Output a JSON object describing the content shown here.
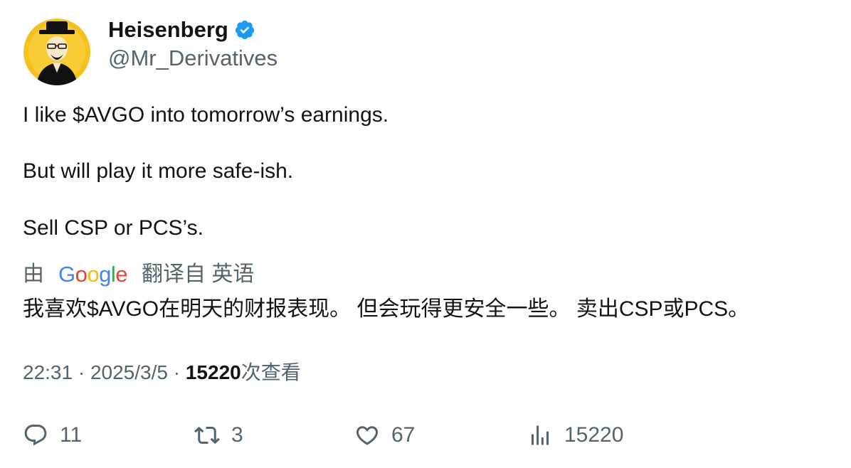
{
  "author": {
    "display_name": "Heisenberg",
    "handle": "@Mr_Derivatives",
    "verified": true
  },
  "tweet": {
    "lines": [
      "I like $AVGO into tomorrow’s earnings.",
      "But will play it more safe-ish.",
      "Sell CSP or PCS’s."
    ]
  },
  "translation": {
    "prefix": "由",
    "provider": "Google",
    "suffix": "翻译自 英语",
    "text": "我喜欢$AVGO在明天的财报表现。 但会玩得更安全一些。 卖出CSP或PCS。"
  },
  "meta": {
    "time": "22:31",
    "separator": "·",
    "date": "2025/3/5",
    "views_count": "15220",
    "views_label": "次查看"
  },
  "actions": {
    "replies": "11",
    "retweets": "3",
    "likes": "67",
    "views": "15220"
  },
  "colors": {
    "verified_blue": "#1d9bf0",
    "avatar_yellow": "#f7c11c",
    "text_primary": "#0f1419",
    "text_secondary": "#536471"
  },
  "icons": {
    "reply": "reply-icon",
    "retweet": "retweet-icon",
    "like": "heart-icon",
    "views": "analytics-icon",
    "verified": "verified-badge-icon"
  }
}
